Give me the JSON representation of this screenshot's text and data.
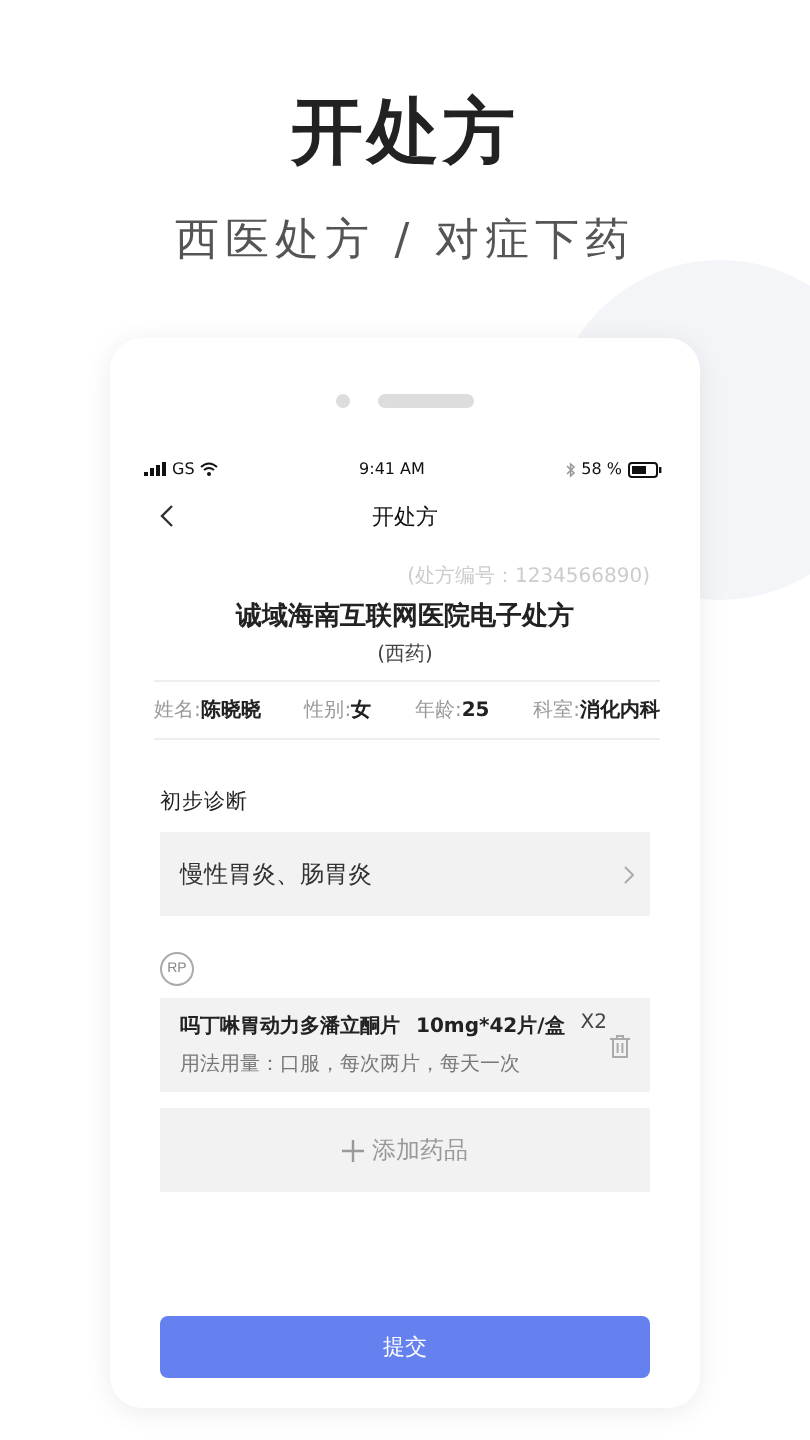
{
  "headline": "开处方",
  "subheadline": "西医处方 / 对症下药",
  "status_bar": {
    "carrier": "GS",
    "time": "9:41 AM",
    "battery": "58 %"
  },
  "nav": {
    "title": "开处方"
  },
  "prescription": {
    "number": "(处方编号：1234566890)",
    "title": "诚域海南互联网医院电子处方",
    "type": "(西药)"
  },
  "patient": [
    {
      "label": "姓名:",
      "value": "陈晓晓"
    },
    {
      "label": "性别:",
      "value": "女"
    },
    {
      "label": "年龄:",
      "value": "25"
    },
    {
      "label": "科室:",
      "value": "消化内科"
    }
  ],
  "diagnosis": {
    "label": "初步诊断",
    "value": "慢性胃炎、肠胃炎"
  },
  "rp_mark": "RP",
  "medicines": [
    {
      "name": "吗丁啉胃动力多潘立酮片",
      "spec": "10mg*42片/盒",
      "qty": "X2",
      "usage": "用法用量：口服，每次两片，每天一次"
    }
  ],
  "add_button": "添加药品",
  "submit_button": "提交"
}
